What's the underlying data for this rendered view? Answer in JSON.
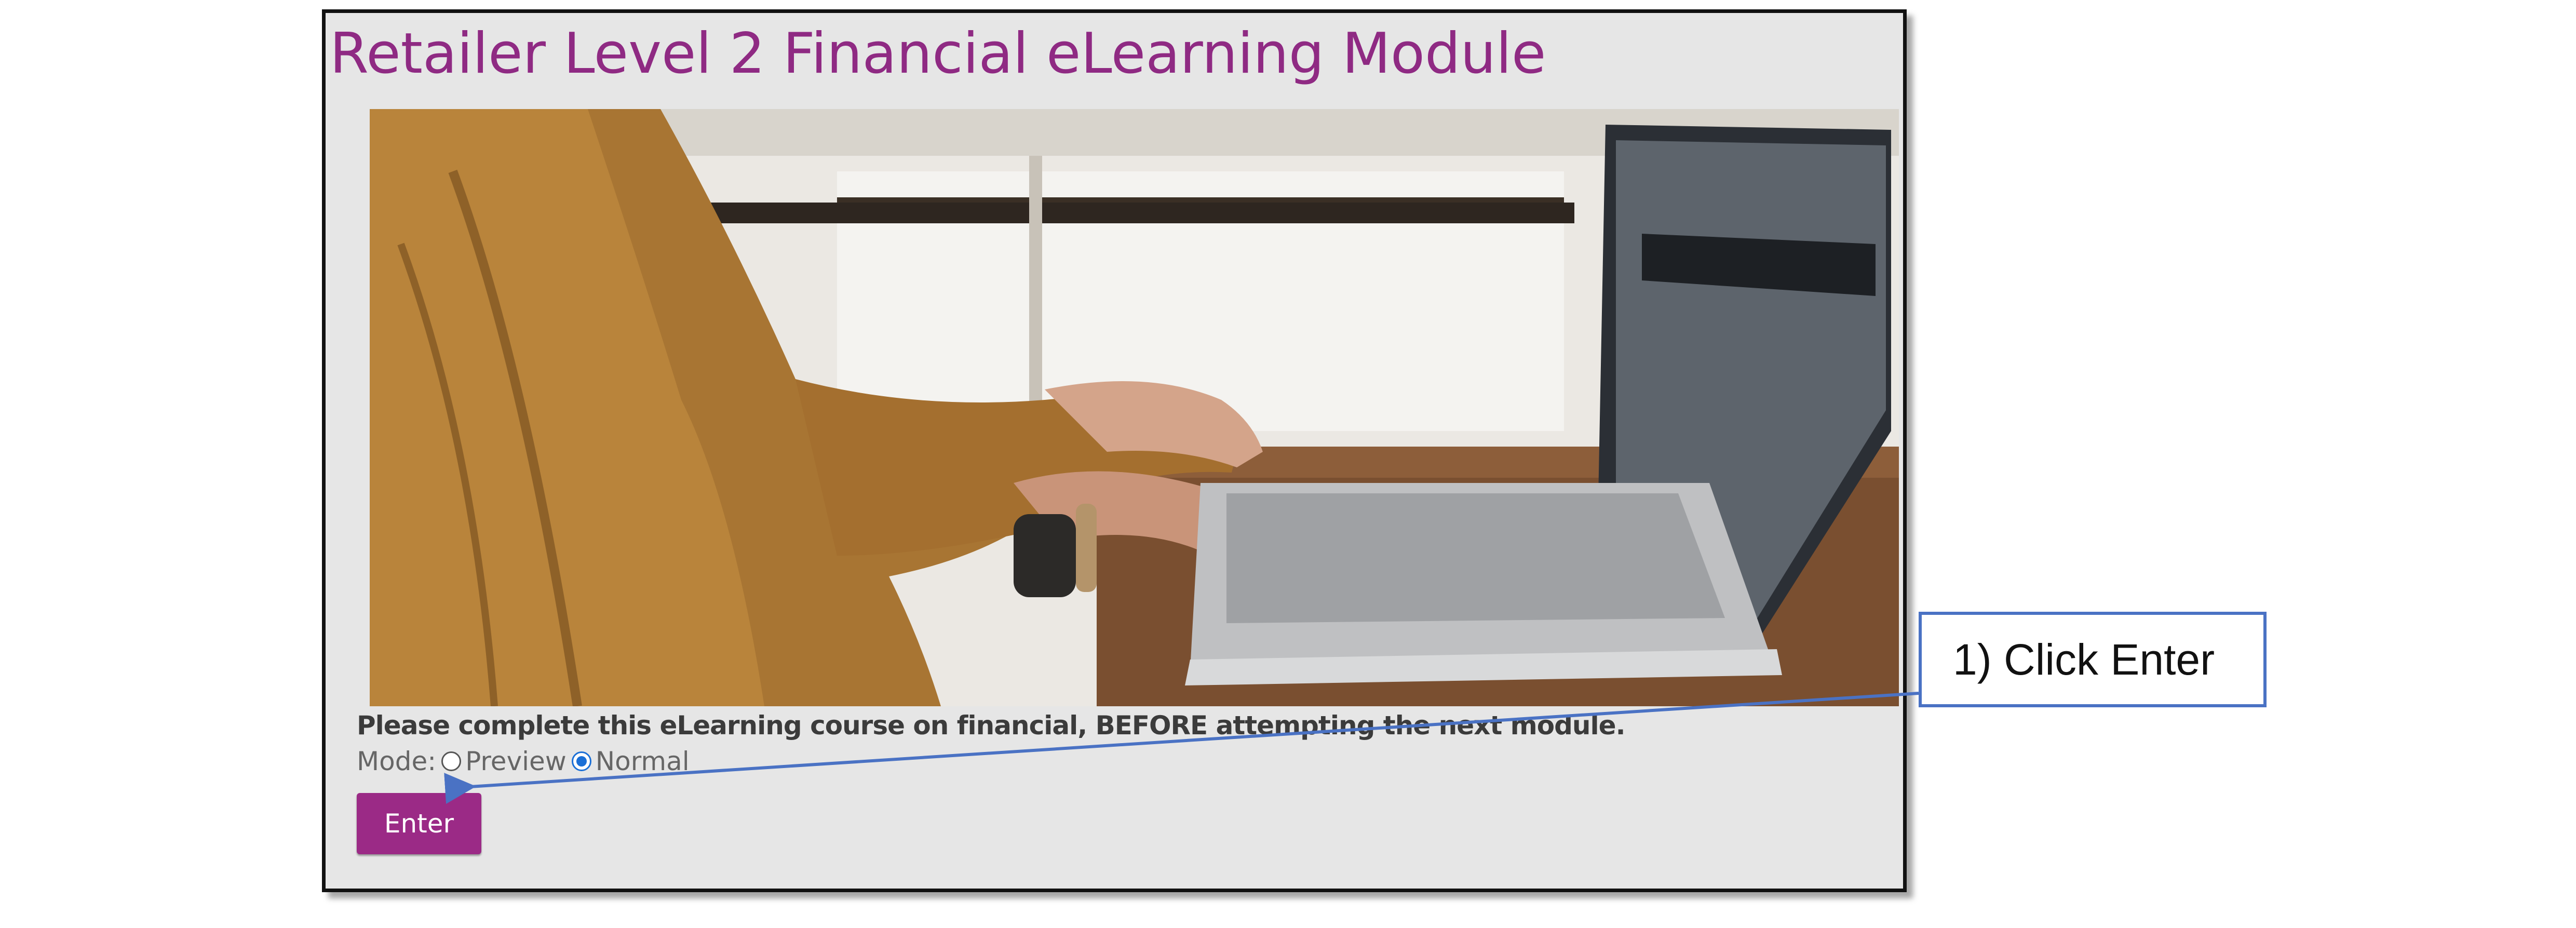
{
  "module": {
    "title": "Retailer Level 2 Financial eLearning Module",
    "intro_text": "Please complete this eLearning course on financial, BEFORE attempting the next module.",
    "mode_label": "Mode:",
    "mode_options": [
      {
        "label": "Preview",
        "selected": false
      },
      {
        "label": "Normal",
        "selected": true
      }
    ],
    "enter_label": "Enter",
    "accent_color": "#9b2a86"
  },
  "annotation": {
    "callout_text": "1) Click Enter",
    "border_color": "#4a72c4"
  },
  "icons": {
    "hero_image": "photo-hands-typing-on-laptop"
  }
}
